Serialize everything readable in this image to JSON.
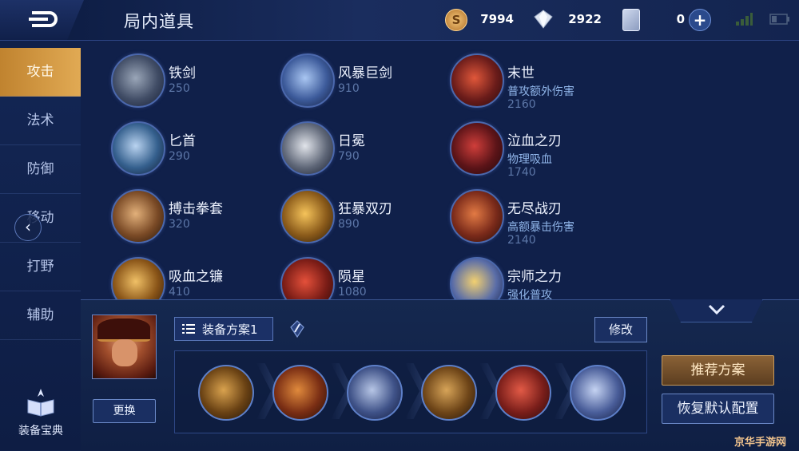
{
  "header": {
    "title": "局内道具",
    "gold": "7994",
    "diamonds": "2922",
    "vouchers": "0"
  },
  "sidebar": {
    "tabs": [
      {
        "label": "攻击",
        "active": true
      },
      {
        "label": "法术",
        "active": false
      },
      {
        "label": "防御",
        "active": false
      },
      {
        "label": "移动",
        "active": false
      },
      {
        "label": "打野",
        "active": false
      },
      {
        "label": "辅助",
        "active": false
      }
    ],
    "codex_label": "装备宝典"
  },
  "items": [
    {
      "name": "铁剑",
      "desc": "",
      "price": "250",
      "icon": "iron-sword-icon"
    },
    {
      "name": "风暴巨剑",
      "desc": "",
      "price": "910",
      "icon": "storm-greatsword-icon"
    },
    {
      "name": "末世",
      "desc": "普攻额外伤害",
      "price": "2160",
      "icon": "doomsday-icon"
    },
    {
      "name": "匕首",
      "desc": "",
      "price": "290",
      "icon": "dagger-icon"
    },
    {
      "name": "日冕",
      "desc": "",
      "price": "790",
      "icon": "corona-icon"
    },
    {
      "name": "泣血之刃",
      "desc": "物理吸血",
      "price": "1740",
      "icon": "bloodweeper-blade-icon"
    },
    {
      "name": "搏击拳套",
      "desc": "",
      "price": "320",
      "icon": "boxing-gauntlet-icon"
    },
    {
      "name": "狂暴双刃",
      "desc": "",
      "price": "890",
      "icon": "berserk-twin-blades-icon"
    },
    {
      "name": "无尽战刃",
      "desc": "高额暴击伤害",
      "price": "2140",
      "icon": "endless-war-blade-icon"
    },
    {
      "name": "吸血之镰",
      "desc": "",
      "price": "410",
      "icon": "vampire-scythe-icon"
    },
    {
      "name": "陨星",
      "desc": "",
      "price": "1080",
      "icon": "meteor-icon"
    },
    {
      "name": "宗师之力",
      "desc": "强化普攻",
      "price": "",
      "icon": "master-power-icon"
    }
  ],
  "plan": {
    "selector_label": "装备方案1",
    "swap_label": "更换",
    "edit_label": "修改",
    "slots": [
      "boots-icon",
      "armor-icon",
      "helm-icon",
      "cloak-icon",
      "scarab-icon",
      "gauntlet-icon"
    ]
  },
  "actions": {
    "recommend_label": "推荐方案",
    "reset_label": "恢复默认配置"
  },
  "watermark": "京华手游网",
  "colors": {
    "active_tab": "#d49a45",
    "background": "#10204a",
    "desc_text": "#8fb4e8",
    "price_text": "#5d77a8"
  }
}
